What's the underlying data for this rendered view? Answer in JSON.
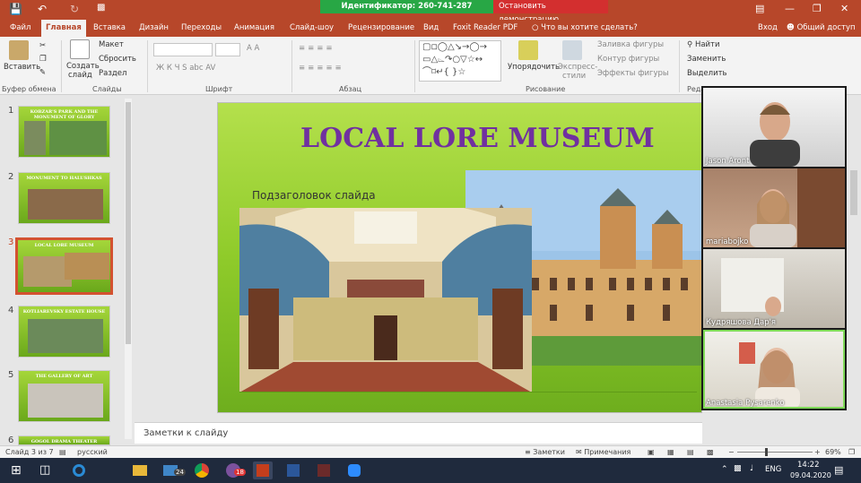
{
  "zoom": {
    "meeting_id_label": "Идентификатор: 260-741-287",
    "stop_share_label": "Остановить демонстрацию"
  },
  "tabs": [
    "Файл",
    "Главная",
    "Вставка",
    "Дизайн",
    "Переходы",
    "Анимация",
    "Слайд-шоу",
    "Рецензирование",
    "Вид",
    "Foxit Reader PDF"
  ],
  "tell_me": "Что вы хотите сделать?",
  "account": {
    "signin": "Вход",
    "share": "Общий доступ"
  },
  "ribbon": {
    "paste": "Вставить",
    "group_clipboard": "Буфер обмена",
    "new_slide": "Создать",
    "new_slide2": "слайд",
    "layout": "Макет",
    "reset": "Сбросить",
    "section": "Раздел",
    "group_slides": "Слайды",
    "group_font": "Шрифт",
    "group_paragraph": "Абзац",
    "arrange": "Упорядочить",
    "quick_styles": "Экспресс-",
    "quick_styles2": "стили",
    "shape_fill": "Заливка фигуры",
    "shape_outline": "Контур фигуры",
    "shape_effects": "Эффекты фигуры",
    "group_drawing": "Рисование",
    "find": "Найти",
    "replace": "Заменить",
    "select": "Выделить",
    "group_edit": "Реда",
    "font_buttons": "Ж К Ч S abc AV",
    "font_size_buttons": "A A"
  },
  "thumbnails": [
    {
      "num": "1",
      "title": "KOBZAR'S PARK AND THE MONUMENT OF GLORY"
    },
    {
      "num": "2",
      "title": "MONUMENT TO HALUSHKAS"
    },
    {
      "num": "3",
      "title": "LOCAL LORE MUSEUM"
    },
    {
      "num": "4",
      "title": "KOTLIAREVSKY ESTATE HOUSE"
    },
    {
      "num": "5",
      "title": "THE GALLERY OF ART"
    },
    {
      "num": "6",
      "title": "GOGOL DRAMA THEATER"
    }
  ],
  "slide": {
    "title": "LOCAL LORE MUSEUM",
    "subtitle": "Подзаголовок слайда"
  },
  "notes_placeholder": "Заметки к слайду",
  "participants": [
    {
      "name": "Jason Aront"
    },
    {
      "name": "mariabojko"
    },
    {
      "name": "Кудряшова Дар'я"
    },
    {
      "name": "Anastasia Pysarenko"
    }
  ],
  "status": {
    "slide_counter": "Слайд 3 из 7",
    "language": "русский",
    "notes": "Заметки",
    "comments": "Примечания",
    "zoom_level": "69%"
  },
  "taskbar": {
    "time": "14:22",
    "date": "09.04.2020",
    "lang": "ENG",
    "mail_badge": "24",
    "viber_badge": "18"
  },
  "colors": {
    "accent": "#b7472a",
    "slide_title": "#7030a0",
    "zoom_green": "#28a745",
    "zoom_red": "#d32f2f"
  }
}
